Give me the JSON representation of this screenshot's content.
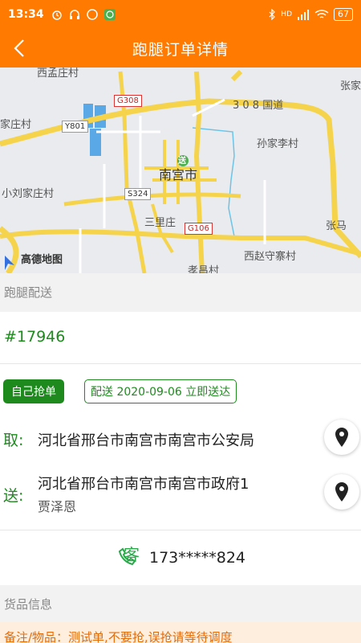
{
  "status_bar": {
    "time": "13:34",
    "battery": "67",
    "network": "HD"
  },
  "header": {
    "title": "跑腿订单详情",
    "back_glyph": "‹"
  },
  "map": {
    "labels": {
      "xi_meng_zhuang": "西孟庄村",
      "zhang": "张家",
      "jia_zhuang": "家庄村",
      "sun_jia_li": "孙家李村",
      "xiao_liu": "小刘家庄村",
      "nan_gong": "南宫市",
      "san_li": "三里庄",
      "zhang_ma": "张马",
      "xi_zhao": "西赵守寨村",
      "xiao_chang": "孝昌村",
      "guodao": "3 0 8 国道",
      "g308": "G308",
      "y801": "Y801",
      "s324": "S324",
      "g106": "G106",
      "song": "送",
      "logo": "高德地图"
    }
  },
  "sections": {
    "delivery_label": "跑腿配送",
    "goods_label": "货品信息"
  },
  "order": {
    "number": "#17946",
    "tag_self": "自己抢单",
    "tag_delivery": "配送 2020-09-06 立即送达",
    "pickup_key": "取:",
    "pickup_address": "河北省邢台市南宫市南宫市公安局",
    "dropoff_key": "送:",
    "dropoff_address": "河北省邢台市南宫市南宫市政府1",
    "dropoff_name": "贾泽恩",
    "customer_glyph": "客",
    "phone": "173*****824"
  },
  "note": {
    "text": "备注/物品：测试单,不要抢,误抢请等待调度"
  },
  "colors": {
    "primary_orange": "#ff7a00",
    "primary_green": "#1e8a1e"
  }
}
